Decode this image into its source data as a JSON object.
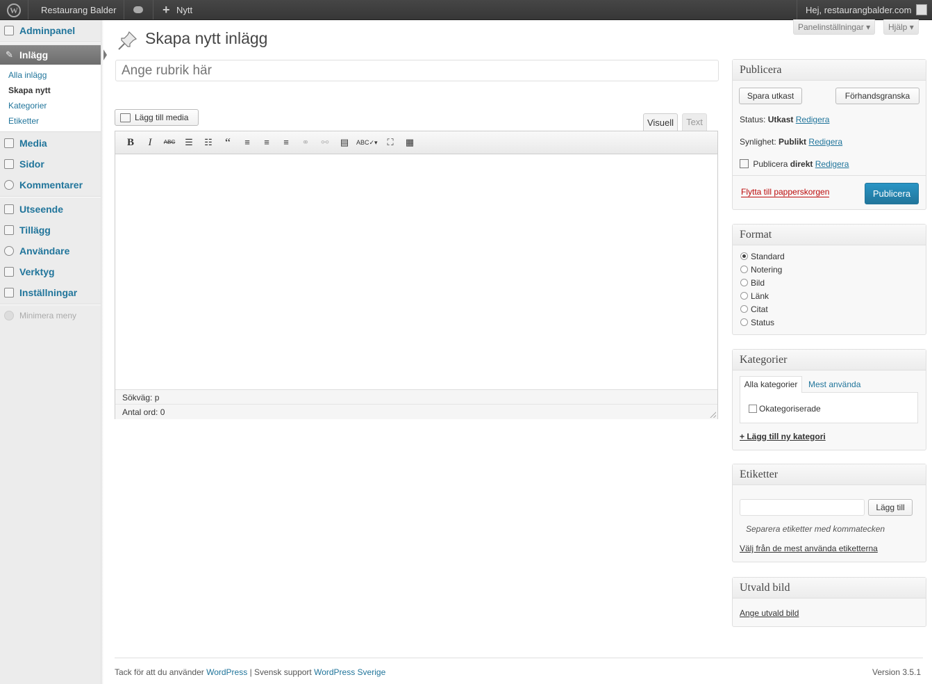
{
  "adminbar": {
    "site_name": "Restaurang Balder",
    "new_label": "Nytt",
    "greeting": "Hej, restaurangbalder.com"
  },
  "sidebar": {
    "dashboard": "Adminpanel",
    "posts": "Inlägg",
    "posts_sub": [
      "Alla inlägg",
      "Skapa nytt",
      "Kategorier",
      "Etiketter"
    ],
    "media": "Media",
    "pages": "Sidor",
    "comments": "Kommentarer",
    "appearance": "Utseende",
    "plugins": "Tillägg",
    "users": "Användare",
    "tools": "Verktyg",
    "settings": "Inställningar",
    "collapse": "Minimera meny"
  },
  "header": {
    "title": "Skapa nytt inlägg",
    "screen_options": "Panelinställningar",
    "help": "Hjälp"
  },
  "editor": {
    "title_placeholder": "Ange rubrik här",
    "add_media": "Lägg till media",
    "tab_visual": "Visuell",
    "tab_text": "Text",
    "path": "Sökväg: p",
    "word_count": "Antal ord: 0"
  },
  "publish": {
    "heading": "Publicera",
    "save_draft": "Spara utkast",
    "preview": "Förhandsgranska",
    "status_label": "Status:",
    "status_value": "Utkast",
    "visibility_label": "Synlighet:",
    "visibility_value": "Publikt",
    "schedule_label": "Publicera",
    "schedule_value": "direkt",
    "edit": "Redigera",
    "trash": "Flytta till papperskorgen",
    "publish_button": "Publicera"
  },
  "format": {
    "heading": "Format",
    "options": [
      "Standard",
      "Notering",
      "Bild",
      "Länk",
      "Citat",
      "Status"
    ],
    "selected": "Standard"
  },
  "categories": {
    "heading": "Kategorier",
    "tab_all": "Alla kategorier",
    "tab_popular": "Mest använda",
    "items": [
      "Okategoriserade"
    ],
    "add_new": "+ Lägg till ny kategori"
  },
  "tags": {
    "heading": "Etiketter",
    "add_button": "Lägg till",
    "hint": "Separera etiketter med kommatecken",
    "choose_link": "Välj från de mest använda etiketterna"
  },
  "featured_image": {
    "heading": "Utvald bild",
    "set_link": "Ange utvald bild"
  },
  "footer": {
    "thanks_prefix": "Tack för att du använder",
    "wp_link": "WordPress",
    "separator": "| Svensk support",
    "wp_se_link": "WordPress Sverige",
    "version": "Version 3.5.1"
  },
  "colors": {
    "link": "#21759b",
    "trash": "#bc0b0b",
    "adminbar": "#464646",
    "primary": "#21759b"
  }
}
